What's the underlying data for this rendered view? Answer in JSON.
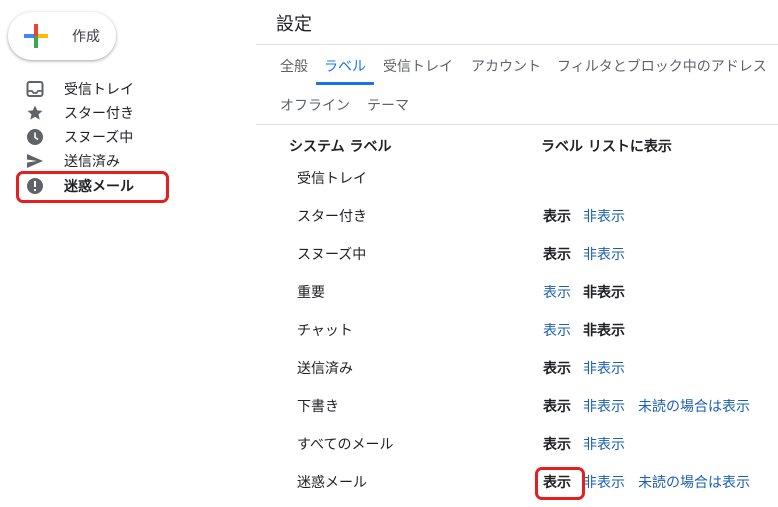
{
  "sidebar": {
    "compose_label": "作成",
    "items": [
      {
        "label": "受信トレイ",
        "icon": "inbox-icon"
      },
      {
        "label": "スター付き",
        "icon": "star-icon"
      },
      {
        "label": "スヌーズ中",
        "icon": "clock-icon"
      },
      {
        "label": "送信済み",
        "icon": "send-icon"
      },
      {
        "label": "迷惑メール",
        "icon": "spam-icon"
      }
    ]
  },
  "settings": {
    "title": "設定",
    "tabs": [
      "全般",
      "ラベル",
      "受信トレイ",
      "アカウント",
      "フィルタとブロック中のアドレス",
      "オフライン",
      "テーマ"
    ],
    "active_tab": "ラベル",
    "headers": {
      "system_labels": "システム ラベル",
      "show_in_list": "ラベル リストに表示"
    },
    "options": {
      "show": "表示",
      "hide": "非表示",
      "show_if_unread": "未読の場合は表示"
    },
    "rows": [
      {
        "label": "受信トレイ",
        "selected": null,
        "has_unread_option": false
      },
      {
        "label": "スター付き",
        "selected": "show",
        "has_unread_option": false
      },
      {
        "label": "スヌーズ中",
        "selected": "show",
        "has_unread_option": false
      },
      {
        "label": "重要",
        "selected": "hide",
        "has_unread_option": false
      },
      {
        "label": "チャット",
        "selected": "hide",
        "has_unread_option": false
      },
      {
        "label": "送信済み",
        "selected": "show",
        "has_unread_option": false
      },
      {
        "label": "下書き",
        "selected": "show",
        "has_unread_option": true
      },
      {
        "label": "すべてのメール",
        "selected": "show",
        "has_unread_option": false
      },
      {
        "label": "迷惑メール",
        "selected": "show",
        "has_unread_option": true
      }
    ]
  },
  "colors": {
    "accent": "#1a73e8",
    "link": "#1a5fb4",
    "highlight": "#e51e1e"
  }
}
